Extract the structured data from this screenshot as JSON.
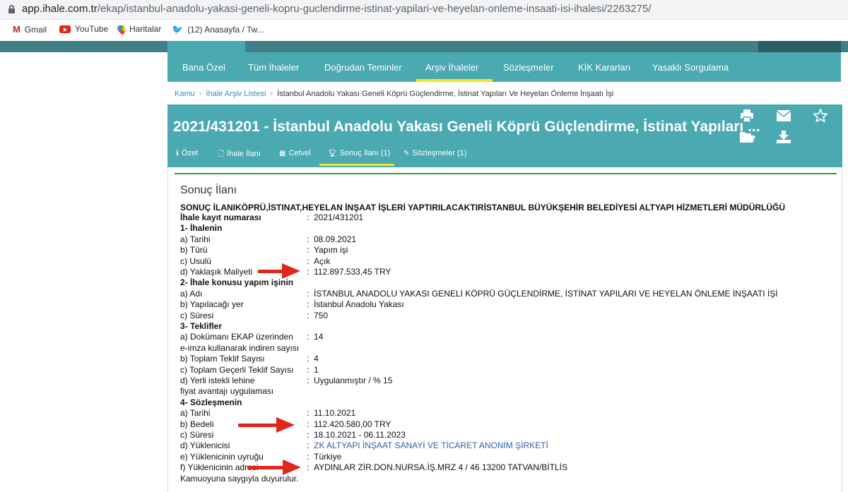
{
  "browser": {
    "url_host": "app.ihale.com.tr",
    "url_path": "/ekap/istanbul-anadolu-yakasi-geneli-kopru-guclendirme-istinat-yapilari-ve-heyelan-onleme-insaati-isi-ihalesi/2263275/",
    "bookmarks": [
      "Gmail",
      "YouTube",
      "Haritalar",
      "(12) Anasayfa / Tw..."
    ]
  },
  "nav": {
    "items": [
      "Bana Özel",
      "Tüm İhaleler",
      "Doğrudan Teminler",
      "Arşiv İhaleler",
      "Sözleşmeler",
      "KİK Kararları",
      "Yasaklı Sorgulama"
    ],
    "active": "Arşiv İhaleler"
  },
  "breadcrumb": {
    "home": "Kamu",
    "list": "İhale Arşiv Listesi",
    "current": "İstanbul Anadolu Yakası Geneli Köprü Güçlendirme, İstinat Yapıları Ve Heyelan Önleme İnşaatı İşi"
  },
  "tender": {
    "title": "2021/431201 - İstanbul Anadolu Yakası Geneli Köprü Güçlendirme, İstinat Yapıları ...",
    "tabs": [
      "Özet",
      "İhale İlanı",
      "Cetvel",
      "Sonuç İlanı (1)",
      "Sözleşmeler (1)"
    ],
    "active_tab": "Sonuç İlanı (1)"
  },
  "result": {
    "section_title": "Sonuç İlanı",
    "header_line": "SONUÇ İLANIKÖPRÜ,İSTINAT,HEYELAN İNŞAAT İŞLERİ YAPTIRILACAKTIRİSTANBUL BÜYÜKŞEHİR BELEDİYESİ ALTYAPI HİZMETLERİ MÜDÜRLÜĞÜ",
    "separator": ":",
    "rows": [
      {
        "label": "İhale kayıt numarası",
        "value": "2021/431201",
        "bold": true
      },
      {
        "label": "1- İhalenin",
        "value": "",
        "bold": true
      },
      {
        "label": "a) Tarihi",
        "value": "08.09.2021"
      },
      {
        "label": "b) Türü",
        "value": "Yapım işi"
      },
      {
        "label": "c) Usulü",
        "value": "Açık"
      },
      {
        "label": "d) Yaklaşık Maliyeti",
        "value": "112.897.533,45 TRY"
      },
      {
        "label": "2- İhale konusu yapım işinin",
        "value": "",
        "bold": true
      },
      {
        "label": "a) Adı",
        "value": "İSTANBUL ANADOLU YAKASI GENELİ KÖPRÜ GÜÇLENDİRME, İSTİNAT YAPILARI VE HEYELAN ÖNLEME İNŞAATI İŞİ"
      },
      {
        "label": "b) Yapılacağı yer",
        "value": "İstanbul Anadolu Yakası"
      },
      {
        "label": "c) Süresi",
        "value": "750"
      },
      {
        "label": "3- Teklifler",
        "value": "",
        "bold": true
      },
      {
        "label": "a) Dokümanı EKAP üzerinden",
        "value": "14"
      },
      {
        "label": "e-imza kullanarak indiren sayısı",
        "value": ""
      },
      {
        "label": "b) Toplam Teklif Sayısı",
        "value": "4"
      },
      {
        "label": "c) Toplam Geçerli Teklif Sayısı",
        "value": "1"
      },
      {
        "label": "d) Yerli istekli lehine",
        "value": "Uygulanmıştır / % 15"
      },
      {
        "label": "fiyat avantajı uygulaması",
        "value": ""
      },
      {
        "label": "4- Sözleşmenin",
        "value": "",
        "bold": true
      },
      {
        "label": "a) Tarihi",
        "value": "11.10.2021"
      },
      {
        "label": "b) Bedeli",
        "value": "112.420.580,00 TRY"
      },
      {
        "label": "c) Süresi",
        "value": "18.10.2021 - 06.11.2023"
      },
      {
        "label": "d) Yüklenicisi",
        "value": "ZK ALTYAPI İNŞAAT SANAYİ VE TİCARET ANONİM ŞİRKETİ",
        "link": true
      },
      {
        "label": "e) Yüklenicinin uyruğu",
        "value": "Türkiye"
      },
      {
        "label": "f) Yüklenicinin adresi",
        "value": "AYDINLAR ZİR.DON.NURSA.İŞ.MRZ 4 / 46 13200 TATVAN/BİTLİS"
      },
      {
        "label": "Kamuoyuna saygıyla duyurulur.",
        "value": ""
      }
    ]
  },
  "colors": {
    "teal": "#4aa9b1",
    "accent_yellow": "#f7e61b",
    "arrow_red": "#e1261c"
  }
}
